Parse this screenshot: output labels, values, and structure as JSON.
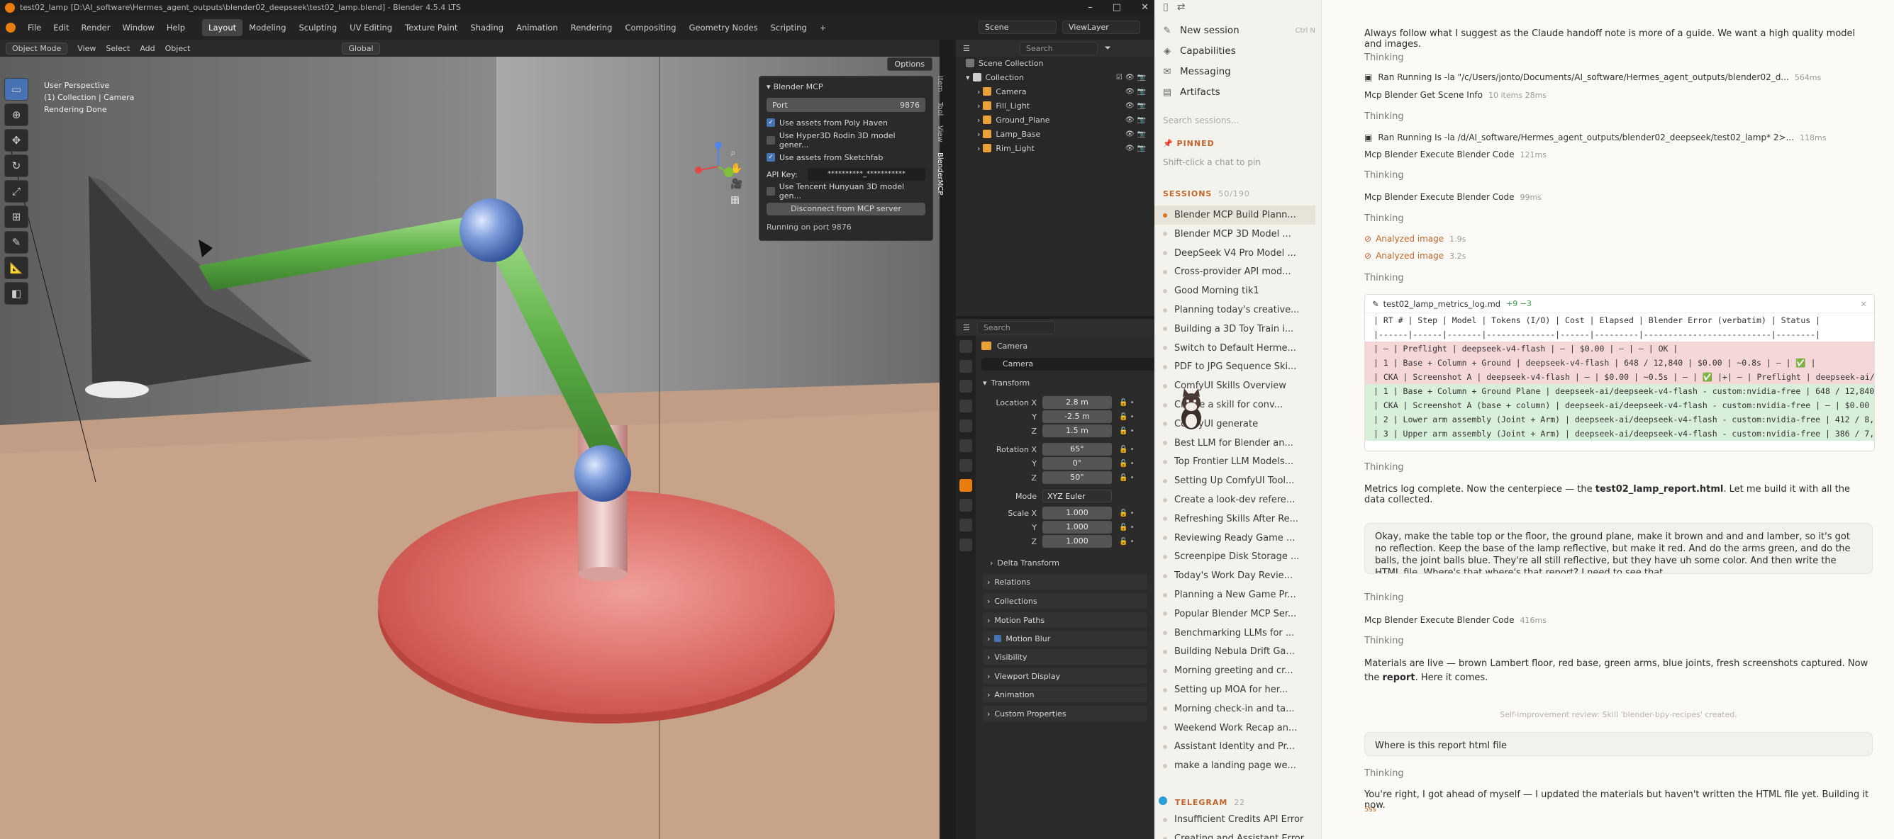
{
  "blender": {
    "window_title": "test02_lamp [D:\\AI_software\\Hermes_agent_outputs\\blender02_deepseek\\test02_lamp.blend] - Blender 4.5.4 LTS",
    "menus": [
      "File",
      "Edit",
      "Render",
      "Window",
      "Help"
    ],
    "workspaces": [
      "Layout",
      "Modeling",
      "Sculpting",
      "UV Editing",
      "Texture Paint",
      "Shading",
      "Animation",
      "Rendering",
      "Compositing",
      "Geometry Nodes",
      "Scripting"
    ],
    "active_workspace": "Layout",
    "scene": "Scene",
    "view_layer": "ViewLayer",
    "viewport_header": {
      "mode": "Object Mode",
      "menu": [
        "View",
        "Select",
        "Add",
        "Object"
      ],
      "orientation": "Global"
    },
    "viewport_info": [
      "User Perspective",
      "(1) Collection | Camera",
      "Rendering Done"
    ],
    "options_label": "Options",
    "mcp_panel": {
      "title": "Blender MCP",
      "port_label": "Port",
      "port_value": "9876",
      "opt1": "Use assets from Poly Haven",
      "opt2": "Use Hyper3D Rodin 3D model gener...",
      "opt3": "Use assets from Sketchfab",
      "api_label": "API Key:",
      "api_value": "**********_***********",
      "opt4": "Use Tencent Hunyuan 3D model gen...",
      "disconnect": "Disconnect from MCP server",
      "status": "Running on port 9876"
    },
    "side_tabs": [
      "Item",
      "Tool",
      "View",
      "BlenderMCP"
    ],
    "outliner": {
      "search_placeholder": "Search",
      "scene_collection": "Scene Collection",
      "collection": "Collection",
      "items": [
        "Camera",
        "Fill_Light",
        "Ground_Plane",
        "Lamp_Base",
        "Rim_Light"
      ]
    },
    "properties": {
      "search_placeholder": "Search",
      "object_name": "Camera",
      "data_name": "Camera",
      "transform": "Transform",
      "location_label": "Location X",
      "location": [
        "2.8 m",
        "-2.5 m",
        "1.5 m"
      ],
      "rotation_label": "Rotation X",
      "rotation": [
        "65°",
        "0°",
        "50°"
      ],
      "mode_label": "Mode",
      "mode_value": "XYZ Euler",
      "scale_label": "Scale X",
      "scale": [
        "1.000",
        "1.000",
        "1.000"
      ],
      "y_label": "Y",
      "z_label": "Z",
      "delta": "Delta Transform",
      "sections": [
        "Relations",
        "Collections",
        "Motion Paths",
        "Motion Blur",
        "Visibility",
        "Viewport Display",
        "Animation",
        "Custom Properties"
      ]
    }
  },
  "chat": {
    "nav": [
      "New session",
      "Capabilities",
      "Messaging",
      "Artifacts"
    ],
    "new_session_shortcut": "Ctrl N",
    "search_placeholder": "Search sessions...",
    "pinned_label": "PINNED",
    "pinned_hint": "Shift-click a chat to pin",
    "sessions_label": "SESSIONS",
    "sessions_count": "50/190",
    "sessions": [
      "Blender MCP Build Plann...",
      "Blender MCP 3D Model ...",
      "DeepSeek V4 Pro Model ...",
      "Cross-provider API mod...",
      "Good Morning tik1",
      "Planning today's creative...",
      "Building a 3D Toy Train i...",
      "Switch to Default Herme...",
      "PDF to JPG Sequence Ski...",
      "ComfyUI Skills Overview",
      "Create a skill for conv...",
      "ComfyUI generate",
      "Best LLM for Blender an...",
      "Top Frontier LLM Models...",
      "Setting Up ComfyUI Tool...",
      "Create a look-dev refere...",
      "Refreshing Skills After Re...",
      "Reviewing Ready Game ...",
      "Screenpipe Disk Storage ...",
      "Today's Work Day Revie...",
      "Planning a New Game Pr...",
      "Popular Blender MCP Ser...",
      "Benchmarking LLMs for ...",
      "Building Nebula Drift Ga...",
      "Morning greeting and cr...",
      "Setting up MOA for her...",
      "Morning check-in and ta...",
      "Weekend Work Recap an...",
      "Assistant Identity and Pr...",
      "make a landing page we..."
    ],
    "telegram_label": "TELEGRAM",
    "telegram_count": "22",
    "telegram_sessions": [
      "Insufficient Credits API Error",
      "Creating and Assistant Error"
    ],
    "main": {
      "top_message": "Always follow what I suggest as the Claude handoff note is more of a guide. We want a high quality model and images.",
      "thinking": "Thinking",
      "tool1": "Ran Running Is -la \"/c/Users/jonto/Documents/AI_software/Hermes_agent_outputs/blender02_d...",
      "tool1_meta": "564ms",
      "tool2": "Mcp Blender Get Scene Info",
      "tool2_meta": "10 items 28ms",
      "tool3": "Ran Running Is -la /d/AI_software/Hermes_agent_outputs/blender02_deepseek/test02_lamp* 2>...",
      "tool3_meta": "118ms",
      "tool4": "Mcp Blender Execute Blender Code",
      "tool4_meta": "121ms",
      "tool5": "Mcp Blender Execute Blender Code",
      "tool5_meta": "99ms",
      "analyzed1": "Analyzed image",
      "analyzed1_meta": "1.9s",
      "analyzed2": "Analyzed image",
      "analyzed2_meta": "3.2s",
      "md_file": "test02_lamp_metrics_log.md",
      "md_diff": "+9 −3",
      "md_lines": [
        "| RT # | Step | Model | Tokens (I/O) | Cost | Elapsed | Blender Error (verbatim) | Status |",
        "|------|------|-------|--------------|------|---------|--------------------------|--------|",
        "| — | Preflight | deepseek-v4-flash | — | $0.00 | — | — | OK |",
        "| 1 | Base + Column + Ground | deepseek-v4-flash | 648 / 12,840 | $0.00 | ~0.8s | — | ✅ |",
        "| CKA | Screenshot A | deepseek-v4-flash | — | $0.00 | ~0.5s | — | ✅ |+| — | Preflight | deepseek-ai/de",
        "| 1 | Base + Column + Ground Plane | deepseek-ai/deepseek-v4-flash - custom:nvidia-free | 648 / 12,840",
        "| CKA | Screenshot A (base + column) | deepseek-ai/deepseek-v4-flash - custom:nvidia-free | — | $0.00 |",
        "| 2 | Lower arm assembly (Joint + Arm) | deepseek-ai/deepseek-v4-flash - custom:nvidia-free | 412 / 8,22",
        "| 3 | Upper arm assembly (Joint + Arm) | deepseek-ai/deepseek-v4-flash - custom:nvidia-free | 386 / 7,8"
      ],
      "metrics_msg_pre": "Metrics log complete. Now the centerpiece — the ",
      "metrics_msg_file": "test02_lamp_report.html",
      "metrics_msg_post": ". Let me build it with all the data collected.",
      "user_msg": "Okay, make the table top or the floor, the ground plane, make it brown and and and lamber, so it's got no reflection. Keep the base of the lamp reflective, but make it red. And do the arms green, and do the balls, the joint balls blue. They're all still reflective, but they have uh some color. And then write the HTML file. Where's that where's that report? I need to see that.",
      "tool6": "Mcp Blender Execute Blender Code",
      "tool6_meta": "416ms",
      "materials_msg_pre": "Materials are live — brown Lambert floor, red base, green arms, blue joints, fresh screenshots captured. Now the ",
      "materials_msg_bold": "report",
      "materials_msg_post": ". Here it comes.",
      "skill_note": "Self-improvement review: Skill 'blender-bpy-recipes' created.",
      "user_msg2": "Where is this report html file",
      "final_msg": "You're right, I got ahead of myself — I updated the materials but haven't written the HTML file yet. Building it now.",
      "final_meta": "5ss"
    }
  },
  "colors": {
    "accent_blue": "#4772b3",
    "blender_orange": "#e87d0d",
    "chat_accent": "#d9772b",
    "lamp_red": "#d9655f",
    "arm_green": "#5fb24a",
    "joint_blue": "#6a8fd6",
    "floor": "#c9a48a"
  }
}
